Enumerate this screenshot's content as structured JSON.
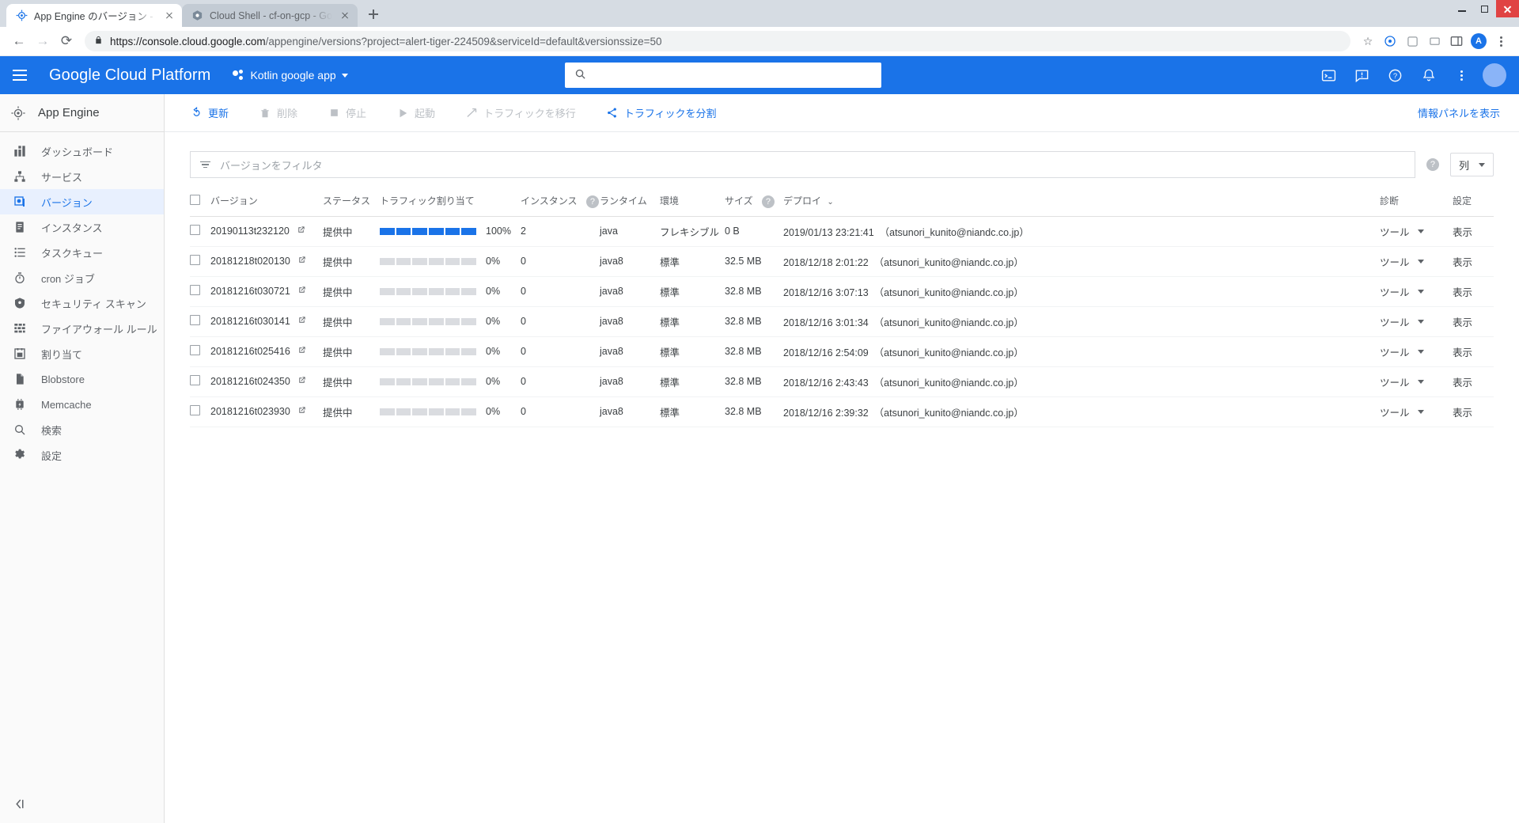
{
  "browser": {
    "tabs": [
      {
        "title": "App Engine のバージョン - Kotl",
        "favicon": "app-engine-icon",
        "active": true
      },
      {
        "title": "Cloud Shell - cf-on-gcp - Goog",
        "favicon": "google-cloud-icon",
        "active": false
      }
    ],
    "new_tab_label": "+",
    "nav": {
      "back": "←",
      "forward": "→",
      "reload": "⟳"
    },
    "url_secure": "https://console.cloud.google.com",
    "url_path": "/appengine/versions?project=alert-tiger-224509&serviceId=default&versionssize=50",
    "omnibar_icons": [
      "star-icon",
      "extension-icon",
      "puzzle-icon",
      "cast-icon",
      "split-screen-icon"
    ],
    "profile_initial": "A",
    "window_controls": [
      "minimize-button",
      "maximize-button",
      "close-button"
    ]
  },
  "gcp_header": {
    "menu_label": "menu-icon",
    "brand": "Google Cloud Platform",
    "project": "Kotlin google app",
    "search_placeholder": "",
    "right_icons": [
      "cloud-shell-icon",
      "feedback-icon",
      "help-icon",
      "notifications-icon",
      "more-icon"
    ],
    "avatar": ""
  },
  "sidebar": {
    "product": "App Engine",
    "product_icon": "app-engine-icon",
    "items": [
      {
        "label": "ダッシュボード",
        "icon": "dashboard-icon",
        "active": false
      },
      {
        "label": "サービス",
        "icon": "services-icon",
        "active": false
      },
      {
        "label": "バージョン",
        "icon": "versions-icon",
        "active": true
      },
      {
        "label": "インスタンス",
        "icon": "instances-icon",
        "active": false
      },
      {
        "label": "タスクキュー",
        "icon": "task-queues-icon",
        "active": false
      },
      {
        "label": "cron ジョブ",
        "icon": "cron-jobs-icon",
        "active": false
      },
      {
        "label": "セキュリティ スキャン",
        "icon": "security-scans-icon",
        "active": false
      },
      {
        "label": "ファイアウォール ルール",
        "icon": "firewall-rules-icon",
        "active": false
      },
      {
        "label": "割り当て",
        "icon": "quotas-icon",
        "active": false
      },
      {
        "label": "Blobstore",
        "icon": "blobstore-icon",
        "active": false
      },
      {
        "label": "Memcache",
        "icon": "memcache-icon",
        "active": false
      },
      {
        "label": "検索",
        "icon": "search-icon",
        "active": false
      },
      {
        "label": "設定",
        "icon": "settings-icon",
        "active": false
      }
    ],
    "collapse_label": "collapse-icon"
  },
  "toolbar": {
    "buttons": [
      {
        "label": "更新",
        "icon": "refresh-icon",
        "enabled": true
      },
      {
        "label": "削除",
        "icon": "delete-icon",
        "enabled": false
      },
      {
        "label": "停止",
        "icon": "stop-icon",
        "enabled": false
      },
      {
        "label": "起動",
        "icon": "start-icon",
        "enabled": false
      },
      {
        "label": "トラフィックを移行",
        "icon": "migrate-traffic-icon",
        "enabled": false
      },
      {
        "label": "トラフィックを分割",
        "icon": "split-traffic-icon",
        "enabled": true
      }
    ],
    "info_panel": "情報パネルを表示"
  },
  "filter": {
    "placeholder": "バージョンをフィルタ",
    "icon": "filter-icon",
    "help_icon": "help-icon",
    "columns_button": "列"
  },
  "table": {
    "columns": [
      {
        "key": "checkbox",
        "label": ""
      },
      {
        "key": "version",
        "label": "バージョン"
      },
      {
        "key": "status",
        "label": "ステータス"
      },
      {
        "key": "traffic",
        "label": "トラフィック割り当て"
      },
      {
        "key": "instances",
        "label": "インスタンス",
        "help": true
      },
      {
        "key": "runtime",
        "label": "ランタイム"
      },
      {
        "key": "environment",
        "label": "環境"
      },
      {
        "key": "size",
        "label": "サイズ",
        "help": true
      },
      {
        "key": "deployed",
        "label": "デプロイ",
        "sorted": true,
        "sort_icon": "chevron-down-icon"
      },
      {
        "key": "diagnose",
        "label": "診断"
      },
      {
        "key": "settings",
        "label": "設定"
      }
    ],
    "rows": [
      {
        "version": "20190113t232120",
        "status": "提供中",
        "traffic_pct": 100,
        "traffic_label": "100%",
        "instances": "2",
        "runtime": "java",
        "environment": "フレキシブル",
        "size": "0 B",
        "deployed": "2019/01/13 23:21:41",
        "deployed_by": "（atsunori_kunito@niandc.co.jp）",
        "diagnose": "ツール",
        "settings": "表示"
      },
      {
        "version": "20181218t020130",
        "status": "提供中",
        "traffic_pct": 0,
        "traffic_label": "0%",
        "instances": "0",
        "runtime": "java8",
        "environment": "標準",
        "size": "32.5 MB",
        "deployed": "2018/12/18 2:01:22",
        "deployed_by": "（atsunori_kunito@niandc.co.jp）",
        "diagnose": "ツール",
        "settings": "表示"
      },
      {
        "version": "20181216t030721",
        "status": "提供中",
        "traffic_pct": 0,
        "traffic_label": "0%",
        "instances": "0",
        "runtime": "java8",
        "environment": "標準",
        "size": "32.8 MB",
        "deployed": "2018/12/16 3:07:13",
        "deployed_by": "（atsunori_kunito@niandc.co.jp）",
        "diagnose": "ツール",
        "settings": "表示"
      },
      {
        "version": "20181216t030141",
        "status": "提供中",
        "traffic_pct": 0,
        "traffic_label": "0%",
        "instances": "0",
        "runtime": "java8",
        "environment": "標準",
        "size": "32.8 MB",
        "deployed": "2018/12/16 3:01:34",
        "deployed_by": "（atsunori_kunito@niandc.co.jp）",
        "diagnose": "ツール",
        "settings": "表示"
      },
      {
        "version": "20181216t025416",
        "status": "提供中",
        "traffic_pct": 0,
        "traffic_label": "0%",
        "instances": "0",
        "runtime": "java8",
        "environment": "標準",
        "size": "32.8 MB",
        "deployed": "2018/12/16 2:54:09",
        "deployed_by": "（atsunori_kunito@niandc.co.jp）",
        "diagnose": "ツール",
        "settings": "表示"
      },
      {
        "version": "20181216t024350",
        "status": "提供中",
        "traffic_pct": 0,
        "traffic_label": "0%",
        "instances": "0",
        "runtime": "java8",
        "environment": "標準",
        "size": "32.8 MB",
        "deployed": "2018/12/16 2:43:43",
        "deployed_by": "（atsunori_kunito@niandc.co.jp）",
        "diagnose": "ツール",
        "settings": "表示"
      },
      {
        "version": "20181216t023930",
        "status": "提供中",
        "traffic_pct": 0,
        "traffic_label": "0%",
        "instances": "0",
        "runtime": "java8",
        "environment": "標準",
        "size": "32.8 MB",
        "deployed": "2018/12/16 2:39:32",
        "deployed_by": "（atsunori_kunito@niandc.co.jp）",
        "diagnose": "ツール",
        "settings": "表示"
      }
    ]
  },
  "colors": {
    "brand_blue": "#1a73e8",
    "header_blue": "#1a73e8",
    "active_row": "#e8f0fe",
    "bar_empty": "#dadce0",
    "text_primary": "#3c4043",
    "text_secondary": "#5f6368"
  }
}
